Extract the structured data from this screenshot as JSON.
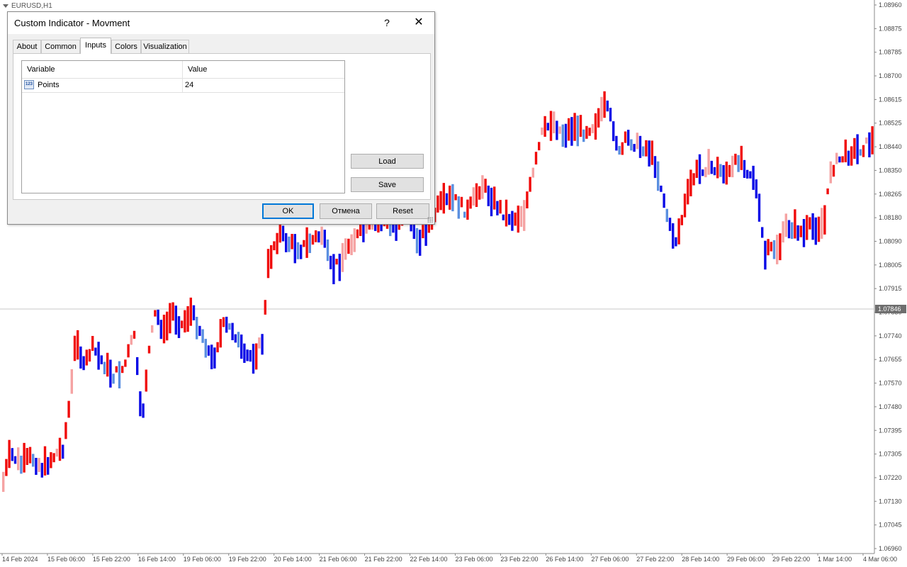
{
  "chart": {
    "symbol_title": "EURUSD,H1",
    "current_price_label": "1.07846",
    "price_axis_labels": [
      "1.08960",
      "1.08875",
      "1.08785",
      "1.08700",
      "1.08615",
      "1.08525",
      "1.08440",
      "1.08350",
      "1.08265",
      "1.08180",
      "1.08090",
      "1.08005",
      "1.07915",
      "1.07830",
      "1.07740",
      "1.07655",
      "1.07570",
      "1.07480",
      "1.07395",
      "1.07305",
      "1.07220",
      "1.07130",
      "1.07045",
      "1.06960"
    ],
    "time_axis_labels": [
      "14 Feb 2024",
      "15 Feb 06:00",
      "15 Feb 22:00",
      "16 Feb 14:00",
      "19 Feb 06:00",
      "19 Feb 22:00",
      "20 Feb 14:00",
      "21 Feb 06:00",
      "21 Feb 22:00",
      "22 Feb 14:00",
      "23 Feb 06:00",
      "23 Feb 22:00",
      "26 Feb 14:00",
      "27 Feb 06:00",
      "27 Feb 22:00",
      "28 Feb 14:00",
      "29 Feb 06:00",
      "29 Feb 22:00",
      "1 Mar 14:00",
      "4 Mar 06:00"
    ],
    "colors": {
      "strong_up": "#f00a0a",
      "weak_up": "#f5a3a3",
      "strong_down": "#0a0ae6",
      "weak_down": "#5a8fe0",
      "axis_text": "#444444",
      "current_price_bg": "#6e6e6e"
    }
  },
  "dialog": {
    "title": "Custom Indicator - Movment",
    "help_label": "?",
    "close_label": "✕",
    "tabs": [
      {
        "label": "About"
      },
      {
        "label": "Common"
      },
      {
        "label": "Inputs"
      },
      {
        "label": "Colors"
      },
      {
        "label": "Visualization"
      }
    ],
    "active_tab": "Inputs",
    "grid": {
      "headers": {
        "variable": "Variable",
        "value": "Value"
      },
      "rows": [
        {
          "icon": "123",
          "variable": "Points",
          "value": "24"
        }
      ]
    },
    "buttons": {
      "load": "Load",
      "save": "Save",
      "ok": "OK",
      "cancel": "Отмена",
      "reset": "Reset"
    }
  }
}
